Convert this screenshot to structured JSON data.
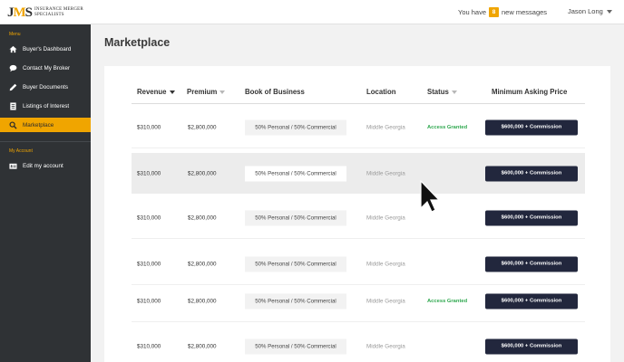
{
  "header": {
    "logo_mark_letters": [
      "J",
      "M",
      "S"
    ],
    "logo_text_line1": "INSURANCE MERGER",
    "logo_text_line2": "SPECIALISTS",
    "messages_prefix": "You have",
    "messages_count": "8",
    "messages_suffix": "new messages",
    "user_name": "Jason Long"
  },
  "sidebar": {
    "menu_label": "Menu",
    "items": [
      {
        "label": "Buyer's Dashboard",
        "icon": "home-icon"
      },
      {
        "label": "Contact My Broker",
        "icon": "chat-bubble-icon"
      },
      {
        "label": "Buyer Documents",
        "icon": "pencil-icon"
      },
      {
        "label": "Listings of Interest",
        "icon": "document-list-icon"
      },
      {
        "label": "Marketplace",
        "icon": "search-icon",
        "active": true
      }
    ],
    "account_label": "My Account",
    "account_items": [
      {
        "label": "Edit my account",
        "icon": "id-card-icon"
      }
    ]
  },
  "page": {
    "title": "Marketplace"
  },
  "table": {
    "columns": {
      "revenue": "Revenue",
      "premium": "Premium",
      "book": "Book of Business",
      "location": "Location",
      "status": "Status",
      "price": "Minimum Asking Price"
    },
    "rows": [
      {
        "revenue": "$310,000",
        "premium": "$2,800,000",
        "book": "50% Personal / 50% Commercial",
        "location": "Middle Georgia",
        "status": "Access Granted",
        "price": "$600,000 + Commission"
      },
      {
        "revenue": "$310,000",
        "premium": "$2,800,000",
        "book": "50% Personal / 50% Commercial",
        "location": "Middle Georgia",
        "status": "",
        "price": "$600,000 + Commission"
      },
      {
        "revenue": "$310,000",
        "premium": "$2,800,000",
        "book": "50% Personal / 50% Commercial",
        "location": "Middle Georgia",
        "status": "",
        "price": "$600,000 + Commission"
      },
      {
        "revenue": "$310,000",
        "premium": "$2,800,000",
        "book": "50% Personal / 50% Commercial",
        "location": "Middle Georgia",
        "status": "",
        "price": "$600,000 + Commission"
      },
      {
        "revenue": "$310,000",
        "premium": "$2,800,000",
        "book": "50% Personal / 50% Commercial",
        "location": "Middle Georgia",
        "status": "Access Granted",
        "price": "$600,000 + Commission"
      },
      {
        "revenue": "$310,000",
        "premium": "$2,800,000",
        "book": "50% Personal / 50% Commercial",
        "location": "Middle Georgia",
        "status": "",
        "price": "$600,000 + Commission"
      }
    ]
  },
  "colors": {
    "accent": "#f0a500",
    "sidebar_bg": "#2f3235",
    "button_bg": "#22273d",
    "status_green": "#2fa84f"
  }
}
